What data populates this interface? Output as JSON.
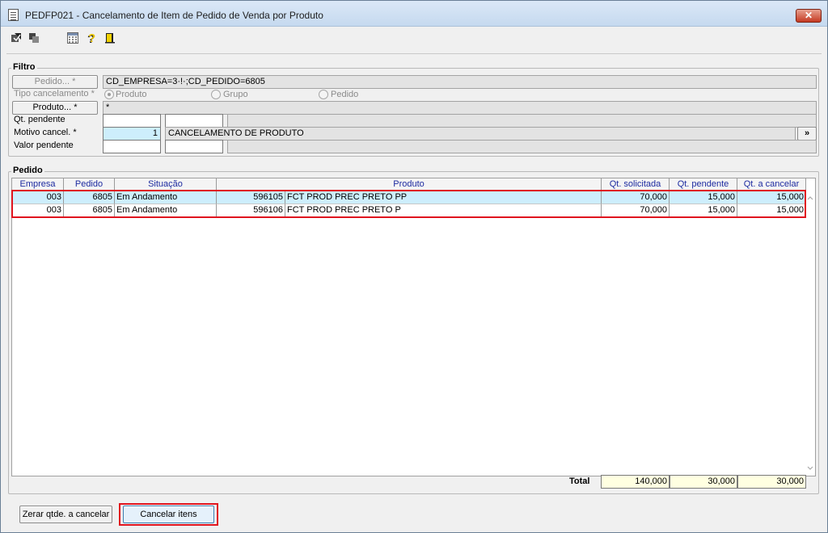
{
  "window": {
    "title": "PEDFP021 - Cancelamento de Item de Pedido de Venda por Produto",
    "close_label": "✕"
  },
  "toolbar": {
    "icons": [
      "confirm-icon",
      "clear-icon",
      "calculator-icon",
      "help-icon",
      "exit-door-icon"
    ]
  },
  "filtro": {
    "title": "Filtro",
    "pedido_button": "Pedido... *",
    "pedido_value": "CD_EMPRESA=3·!·;CD_PEDIDO=6805",
    "tipo_label": "Tipo cancelamento *",
    "tipo_options": [
      "Produto",
      "Grupo",
      "Pedido"
    ],
    "tipo_selected": "Produto",
    "produto_button": "Produto... *",
    "produto_value": "*",
    "qt_pendente_label": "Qt. pendente",
    "motivo_label": "Motivo cancel. *",
    "motivo_code": "1",
    "motivo_desc": "CANCELAMENTO DE PRODUTO",
    "motivo_lookup": "»",
    "valor_pendente_label": "Valor pendente"
  },
  "pedido": {
    "title": "Pedido",
    "columns": [
      "Empresa",
      "Pedido",
      "Situação",
      "Produto",
      "Qt. solicitada",
      "Qt. pendente",
      "Qt. a cancelar"
    ],
    "rows": [
      {
        "empresa": "003",
        "pedido": "6805",
        "situacao": "Em Andamento",
        "produto_cod": "596105",
        "produto_desc": "FCT PROD PREC PRETO PP",
        "qt_solicitada": "70,000",
        "qt_pendente": "15,000",
        "qt_cancelar": "15,000"
      },
      {
        "empresa": "003",
        "pedido": "6805",
        "situacao": "Em Andamento",
        "produto_cod": "596106",
        "produto_desc": "FCT PROD PREC PRETO P",
        "qt_solicitada": "70,000",
        "qt_pendente": "15,000",
        "qt_cancelar": "15,000"
      }
    ],
    "total_label": "Total",
    "total_qt_solicitada": "140,000",
    "total_qt_pendente": "30,000",
    "total_qt_cancelar": "30,000"
  },
  "actions": {
    "zerar_label": "Zerar qtde. a cancelar",
    "cancelar_label": "Cancelar itens"
  },
  "colors": {
    "selected_row": "#cdeefc",
    "highlight_box": "#e0141e",
    "header_text": "#1d2ba0",
    "total_bg": "#ffffe1"
  }
}
